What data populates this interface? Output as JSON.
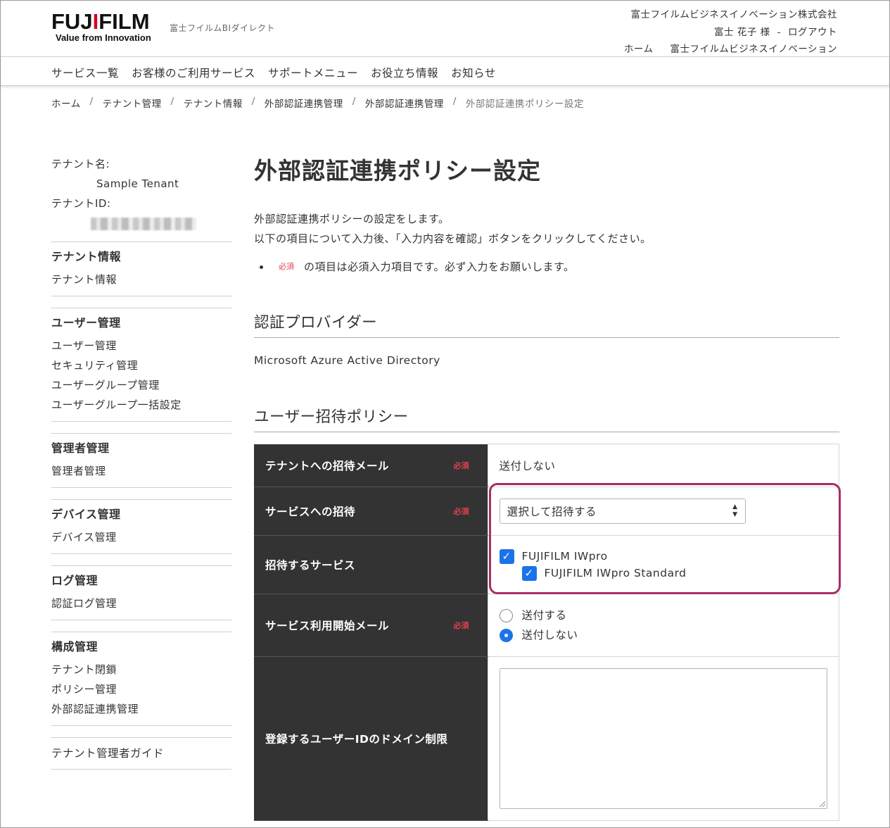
{
  "header": {
    "logo_main": "FUJIFILM",
    "logo_tagline": "Value from Innovation",
    "site_name": "富士フイルムBIダイレクト",
    "company": "富士フイルムビジネスイノベーション株式会社",
    "user_name": "富士 花子 様",
    "separator": "-",
    "logout": "ログアウト",
    "home": "ホーム",
    "company_link": "富士フイルムビジネスイノベーション"
  },
  "gnav": [
    "サービス一覧",
    "お客様のご利用サービス",
    "サポートメニュー",
    "お役立ち情報",
    "お知らせ"
  ],
  "breadcrumb": [
    "ホーム",
    "テナント管理",
    "テナント情報",
    "外部認証連携管理",
    "外部認証連携管理",
    "外部認証連携ポリシー設定"
  ],
  "sidebar": {
    "tenant_name_label": "テナント名:",
    "tenant_name": "Sample Tenant",
    "tenant_id_label": "テナントID:",
    "groups": [
      {
        "title": "テナント情報",
        "items": [
          "テナント情報"
        ]
      },
      {
        "title": "ユーザー管理",
        "items": [
          "ユーザー管理",
          "セキュリティ管理",
          "ユーザーグループ管理",
          "ユーザーグループ一括設定"
        ]
      },
      {
        "title": "管理者管理",
        "items": [
          "管理者管理"
        ]
      },
      {
        "title": "デバイス管理",
        "items": [
          "デバイス管理"
        ]
      },
      {
        "title": "ログ管理",
        "items": [
          "認証ログ管理"
        ]
      },
      {
        "title": "構成管理",
        "items": [
          "テナント閉鎖",
          "ポリシー管理",
          "外部認証連携管理"
        ]
      }
    ],
    "guide": "テナント管理者ガイド"
  },
  "main": {
    "title": "外部認証連携ポリシー設定",
    "desc1": "外部認証連携ポリシーの設定をします。",
    "desc2": "以下の項目について入力後、「入力内容を確認」ボタンをクリックしてください。",
    "required_badge": "必須",
    "required_note": "の項目は必須入力項目です。必ず入力をお願いします。",
    "section_provider": "認証プロバイダー",
    "provider_value": "Microsoft Azure Active Directory",
    "section_invite": "ユーザー招待ポリシー",
    "rows": {
      "tenant_mail": {
        "label": "テナントへの招待メール",
        "value": "送付しない"
      },
      "service_invite": {
        "label": "サービスへの招待",
        "selected": "選択して招待する"
      },
      "services": {
        "label": "招待するサービス",
        "parent": "FUJIFILM IWpro",
        "child": "FUJIFILM IWpro Standard"
      },
      "start_mail": {
        "label": "サービス利用開始メール",
        "opt_send": "送付する",
        "opt_nosend": "送付しない"
      },
      "domain": {
        "label": "登録するユーザーIDのドメイン制限"
      }
    }
  },
  "colors": {
    "accent": "#1a73e8",
    "required": "#e0404e",
    "highlight": "#a62f64",
    "header_cell": "#333333"
  }
}
